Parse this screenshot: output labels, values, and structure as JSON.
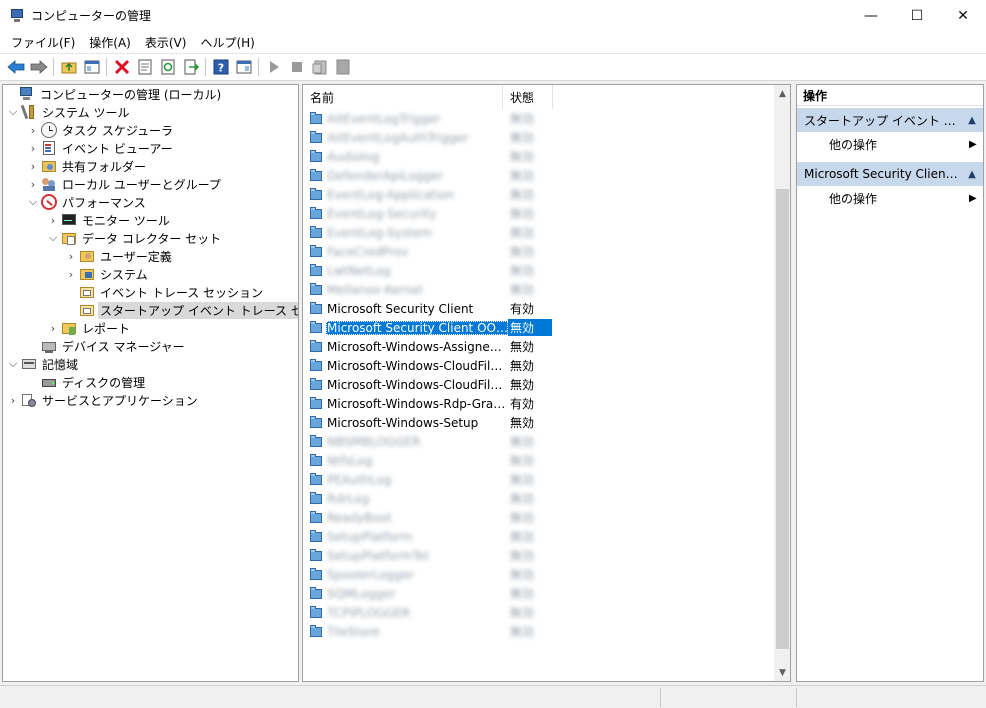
{
  "window": {
    "title": "コンピューターの管理",
    "minimize_glyph": "—",
    "maximize_glyph": "☐",
    "close_glyph": "✕"
  },
  "menu": [
    "ファイル(F)",
    "操作(A)",
    "表示(V)",
    "ヘルプ(H)"
  ],
  "tree": {
    "root": "コンピューターの管理 (ローカル)",
    "system_tools": "システム ツール",
    "task_scheduler": "タスク スケジューラ",
    "event_viewer": "イベント ビューアー",
    "shared_folders": "共有フォルダー",
    "local_users": "ローカル ユーザーとグループ",
    "performance": "パフォーマンス",
    "monitor_tools": "モニター ツール",
    "data_collector_sets": "データ コレクター セット",
    "user_defined": "ユーザー定義",
    "system": "システム",
    "event_trace_sessions": "イベント トレース セッション",
    "startup_event_trace": "スタートアップ イベント トレース セッション",
    "reports": "レポート",
    "device_manager": "デバイス マネージャー",
    "storage": "記憶域",
    "disk_management": "ディスクの管理",
    "services_apps": "サービスとアプリケーション"
  },
  "list": {
    "columns": {
      "name": "名前",
      "state": "状態"
    },
    "rows": [
      {
        "name": "AitEventLogTrigger",
        "state": "無効",
        "blurred": true
      },
      {
        "name": "AitEventLogAuthTrigger",
        "state": "無効",
        "blurred": true
      },
      {
        "name": "Audiolog",
        "state": "無効",
        "blurred": true
      },
      {
        "name": "DefenderApiLogger",
        "state": "無効",
        "blurred": true
      },
      {
        "name": "EventLog-Application",
        "state": "無効",
        "blurred": true
      },
      {
        "name": "EventLog-Security",
        "state": "無効",
        "blurred": true
      },
      {
        "name": "EventLog-System",
        "state": "無効",
        "blurred": true
      },
      {
        "name": "FaceCredProv",
        "state": "無効",
        "blurred": true
      },
      {
        "name": "LwtNetLog",
        "state": "無効",
        "blurred": true
      },
      {
        "name": "Mellanox-Kernel",
        "state": "無効",
        "blurred": true
      },
      {
        "name": "Microsoft Security Client",
        "state": "有効",
        "blurred": false
      },
      {
        "name": "Microsoft Security Client OOBE",
        "state": "無効",
        "blurred": false,
        "selected": true
      },
      {
        "name": "Microsoft-Windows-AssignedA...",
        "state": "無効",
        "blurred": false
      },
      {
        "name": "Microsoft-Windows-CloudFiles...",
        "state": "無効",
        "blurred": false
      },
      {
        "name": "Microsoft-Windows-CloudFiles...",
        "state": "無効",
        "blurred": false
      },
      {
        "name": "Microsoft-Windows-Rdp-Grap...",
        "state": "有効",
        "blurred": false
      },
      {
        "name": "Microsoft-Windows-Setup",
        "state": "無効",
        "blurred": false
      },
      {
        "name": "NBSMBLOGGER",
        "state": "無効",
        "blurred": true
      },
      {
        "name": "NtfsLog",
        "state": "無効",
        "blurred": true
      },
      {
        "name": "PEAuthLog",
        "state": "無効",
        "blurred": true
      },
      {
        "name": "RdrLog",
        "state": "無効",
        "blurred": true
      },
      {
        "name": "ReadyBoot",
        "state": "無効",
        "blurred": true
      },
      {
        "name": "SetupPlatform",
        "state": "無効",
        "blurred": true
      },
      {
        "name": "SetupPlatformTel",
        "state": "無効",
        "blurred": true
      },
      {
        "name": "SpoolerLogger",
        "state": "無効",
        "blurred": true
      },
      {
        "name": "SQMLogger",
        "state": "無効",
        "blurred": true
      },
      {
        "name": "TCPIPLOGGER",
        "state": "無効",
        "blurred": true
      },
      {
        "name": "TileStore",
        "state": "無効",
        "blurred": true
      }
    ]
  },
  "actions": {
    "header": "操作",
    "section1": "スタートアップ イベント トレース ...",
    "section2": "Microsoft Security Client O...",
    "other_ops": "他の操作"
  },
  "icons": {
    "back": "arrow-left-icon",
    "forward": "arrow-right-icon",
    "delete": "delete-x-icon",
    "help": "help-icon",
    "start": "play-icon",
    "stop": "stop-icon"
  },
  "colors": {
    "selection": "#0078d7",
    "action_section": "#c7d7ec",
    "tree_selected": "#d9d9d9"
  }
}
